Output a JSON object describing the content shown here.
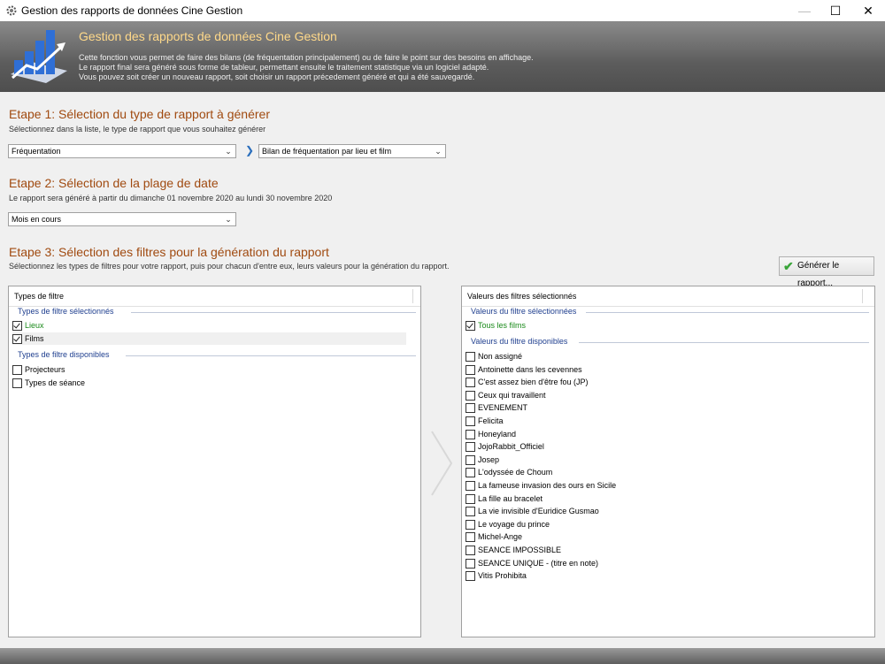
{
  "window": {
    "title": "Gestion des rapports de données Cine Gestion",
    "minimize_glyph": "—",
    "maximize_glyph": "☐",
    "close_glyph": "✕"
  },
  "banner": {
    "title": "Gestion des rapports de données Cine Gestion",
    "lines": [
      "Cette fonction vous permet de faire des bilans (de fréquentation principalement) ou de faire le point sur des besoins en affichage.",
      "Le rapport final sera généré sous forme de tableur, permettant ensuite le traitement statistique via un logiciel adapté.",
      "Vous pouvez soit créer un nouveau rapport, soit choisir un rapport précedement généré et qui a été sauvegardé."
    ]
  },
  "step1": {
    "title": "Etape 1: Sélection du type de rapport à générer",
    "desc": "Sélectionnez dans la liste, le type de rapport que vous souhaitez générer",
    "type_value": "Fréquentation",
    "report_value": "Bilan de fréquentation par lieu et film"
  },
  "step2": {
    "title": "Etape 2: Sélection de la plage de date",
    "desc": "Le rapport sera généré à partir du dimanche 01 novembre 2020 au lundi 30 novembre 2020",
    "period_value": "Mois en cours"
  },
  "step3": {
    "title": "Etape 3: Sélection des filtres pour la génération du rapport",
    "desc": "Sélectionnez les types de filtres pour votre rapport, puis pour chacun d'entre eux, leurs valeurs pour la génération du rapport.",
    "generate_label": "Générer le rapport..."
  },
  "left_panel": {
    "header": "Types de filtre",
    "selected_group": "Types de filtre sélectionnés",
    "available_group": "Types de filtre disponibles",
    "selected": [
      {
        "label": "Lieux",
        "checked": true
      },
      {
        "label": "Films",
        "checked": true
      }
    ],
    "available": [
      {
        "label": "Projecteurs",
        "checked": false
      },
      {
        "label": "Types de séance",
        "checked": false
      }
    ]
  },
  "right_panel": {
    "header": "Valeurs des filtres sélectionnés",
    "selected_group": "Valeurs du filtre sélectionnées",
    "available_group": "Valeurs du filtre disponibles",
    "selected": [
      {
        "label": "Tous les films",
        "checked": true
      }
    ],
    "available": [
      {
        "label": "Non assigné",
        "checked": false
      },
      {
        "label": "Antoinette dans les cevennes",
        "checked": false
      },
      {
        "label": "C'est assez bien d'être fou (JP)",
        "checked": false
      },
      {
        "label": "Ceux qui travaillent",
        "checked": false
      },
      {
        "label": "EVENEMENT",
        "checked": false
      },
      {
        "label": "Felicita",
        "checked": false
      },
      {
        "label": "Honeyland",
        "checked": false
      },
      {
        "label": "JojoRabbit_Officiel",
        "checked": false
      },
      {
        "label": "Josep",
        "checked": false
      },
      {
        "label": "L'odyssée de Choum",
        "checked": false
      },
      {
        "label": "La fameuse invasion des ours en Sicile",
        "checked": false
      },
      {
        "label": "La fille au bracelet",
        "checked": false
      },
      {
        "label": "La vie invisible d'Euridice Gusmao",
        "checked": false
      },
      {
        "label": "Le voyage du prince",
        "checked": false
      },
      {
        "label": "Michel-Ange",
        "checked": false
      },
      {
        "label": "SEANCE IMPOSSIBLE",
        "checked": false
      },
      {
        "label": "SEANCE UNIQUE - (titre en note)",
        "checked": false
      },
      {
        "label": "Vitis Prohibita",
        "checked": false
      }
    ]
  },
  "colors": {
    "step_title": "#a04a10",
    "banner_title": "#ffd98a",
    "group_header": "#1f3f8f",
    "checked_item": "#1a8a1a"
  }
}
